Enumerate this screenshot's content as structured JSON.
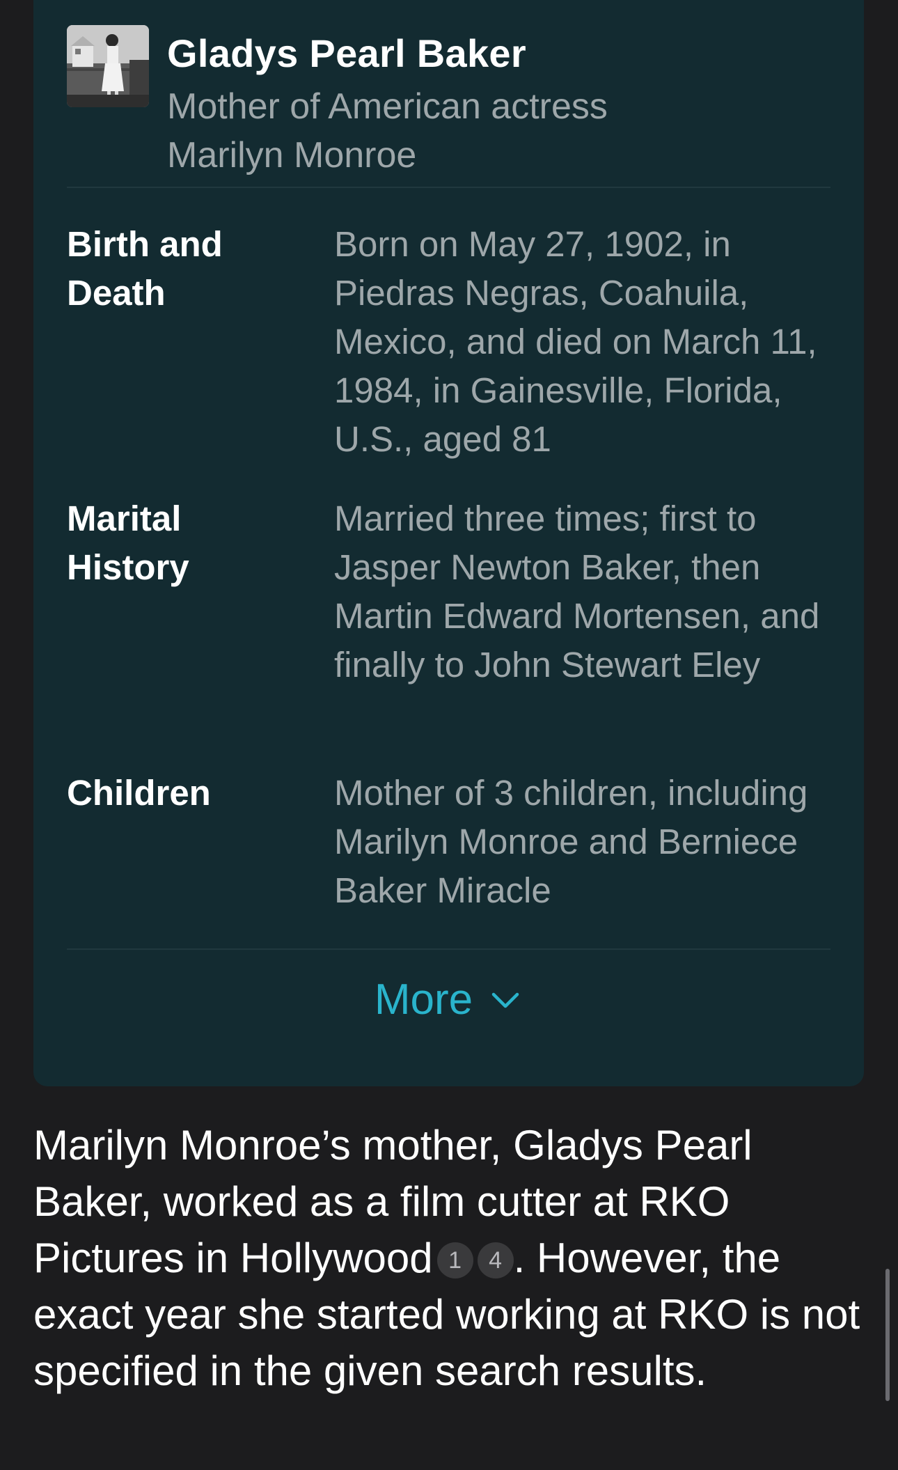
{
  "profile_card": {
    "name": "Gladys Pearl Baker",
    "description": "Mother of American actress Marilyn Monroe",
    "rows": [
      {
        "label": "Birth and Death",
        "value": "Born on May 27, 1902, in Piedras Negras, Coahuila, Mexico, and died on March 11, 1984, in Gainesville, Florida, U.S., aged 81"
      },
      {
        "label": "Marital History",
        "value": "Married three times; first to Jasper Newton Baker, then Martin Edward Mortensen, and finally to John Stewart Eley"
      },
      {
        "label": "Children",
        "value": "Mother of 3 children, including Marilyn Monroe and Berniece Baker Miracle"
      }
    ],
    "more_label": "More",
    "more_icon": "chevron-down-icon",
    "thumbnail_icon": "profile-photo"
  },
  "answer": {
    "part1": "Marilyn Monroe’s mother, Gladys Pearl Baker, worked as a film cutter at RKO Pictures in Hollywood",
    "citations": [
      "1",
      "4"
    ],
    "part2": ". However, the exact year she started working at RKO is not specified in the given search results."
  },
  "colors": {
    "background": "#1c1c1e",
    "card": "#132b31",
    "accent": "#2ab4cc",
    "secondary_text": "#9ea7aa"
  }
}
